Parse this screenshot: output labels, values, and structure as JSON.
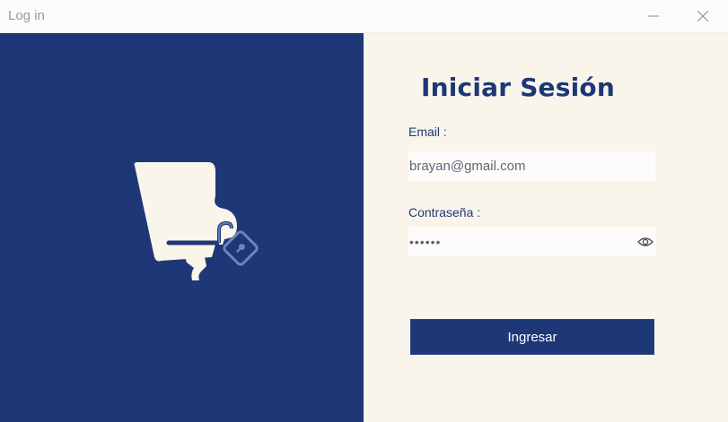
{
  "window": {
    "title": "Log in",
    "minimize_icon": "minimize-icon",
    "close_icon": "close-icon"
  },
  "colors": {
    "brand": "#1d3777",
    "panel_background": "#faf5eb"
  },
  "logo": {
    "icon": "brand-logo-b-with-lock"
  },
  "login": {
    "heading": "Iniciar Sesión",
    "email_label": "Email :",
    "email_value": "brayan@gmail.com",
    "password_label": "Contraseña :",
    "password_value": "••••••",
    "show_password_icon": "eye-icon",
    "submit_label": "Ingresar"
  }
}
